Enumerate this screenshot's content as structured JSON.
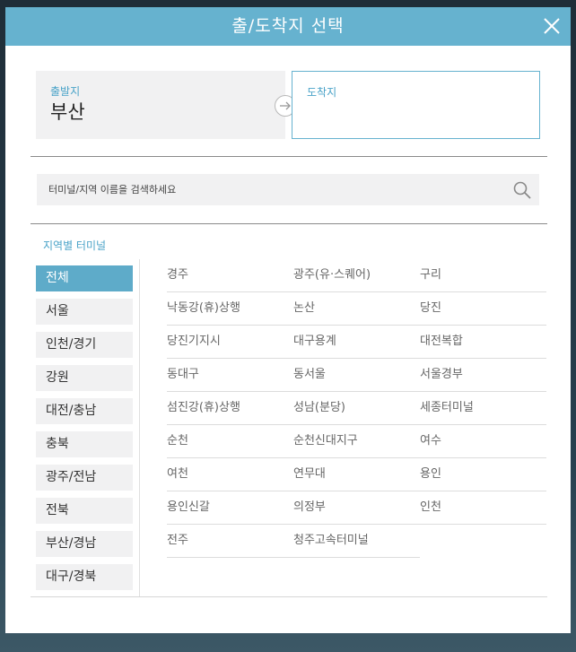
{
  "dialog": {
    "title": "출/도착지 선택"
  },
  "departure": {
    "label": "출발지",
    "value": "부산"
  },
  "arrival": {
    "label": "도착지",
    "value": ""
  },
  "search": {
    "placeholder": "터미널/지역 이름을 검색하세요"
  },
  "region_section": {
    "title": "지역별 터미널"
  },
  "regions": [
    {
      "label": "전체",
      "active": true
    },
    {
      "label": "서울",
      "active": false
    },
    {
      "label": "인천/경기",
      "active": false
    },
    {
      "label": "강원",
      "active": false
    },
    {
      "label": "대전/충남",
      "active": false
    },
    {
      "label": "충북",
      "active": false
    },
    {
      "label": "광주/전남",
      "active": false
    },
    {
      "label": "전북",
      "active": false
    },
    {
      "label": "부산/경남",
      "active": false
    },
    {
      "label": "대구/경북",
      "active": false
    }
  ],
  "terminals": [
    "경주",
    "광주(유·스퀘어)",
    "구리",
    "낙동강(휴)상행",
    "논산",
    "당진",
    "당진기지시",
    "대구용계",
    "대전복합",
    "동대구",
    "동서울",
    "서울경부",
    "섬진강(휴)상행",
    "성남(분당)",
    "세종터미널",
    "순천",
    "순천신대지구",
    "여수",
    "여천",
    "연무대",
    "용인",
    "용인신갈",
    "의정부",
    "인천",
    "전주",
    "청주고속터미널"
  ],
  "colors": {
    "accent": "#66b2cf",
    "active_region": "#5eabc9",
    "panel": "#f1f1f2"
  },
  "icons": {
    "close": "close-icon",
    "search": "search-icon",
    "arrow": "arrow-right-icon"
  }
}
